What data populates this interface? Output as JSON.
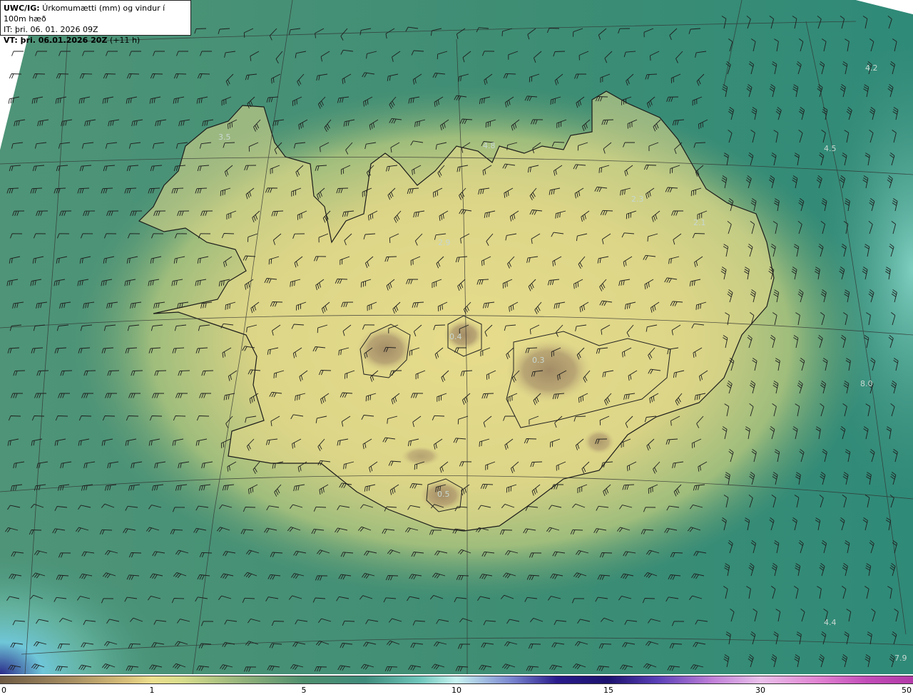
{
  "header": {
    "product": "UWC/IG:",
    "title": "Úrkomumætti (mm) og vindur í 100m hæð",
    "it_line": "IT: þri. 06. 01. 2026 09Z",
    "vt_label": "VT: þri. 06.01.2026 20Z",
    "vt_offset": "(+11 h)"
  },
  "map_labels": [
    "4.2",
    "3.5",
    "4.8",
    "2.3",
    "2.1",
    "4.5",
    "0.4",
    "0.3",
    "8.0",
    "0.5",
    "4.4",
    "7.9",
    "2.9"
  ],
  "colorbar": {
    "ticks": [
      "0",
      "1",
      "5",
      "10",
      "15",
      "30",
      "50"
    ]
  },
  "colors": {
    "sea_teal": "#3f8f78",
    "land_yellow": "#e6da8a",
    "highland_brown": "#a89468",
    "graticule": "#333333"
  }
}
